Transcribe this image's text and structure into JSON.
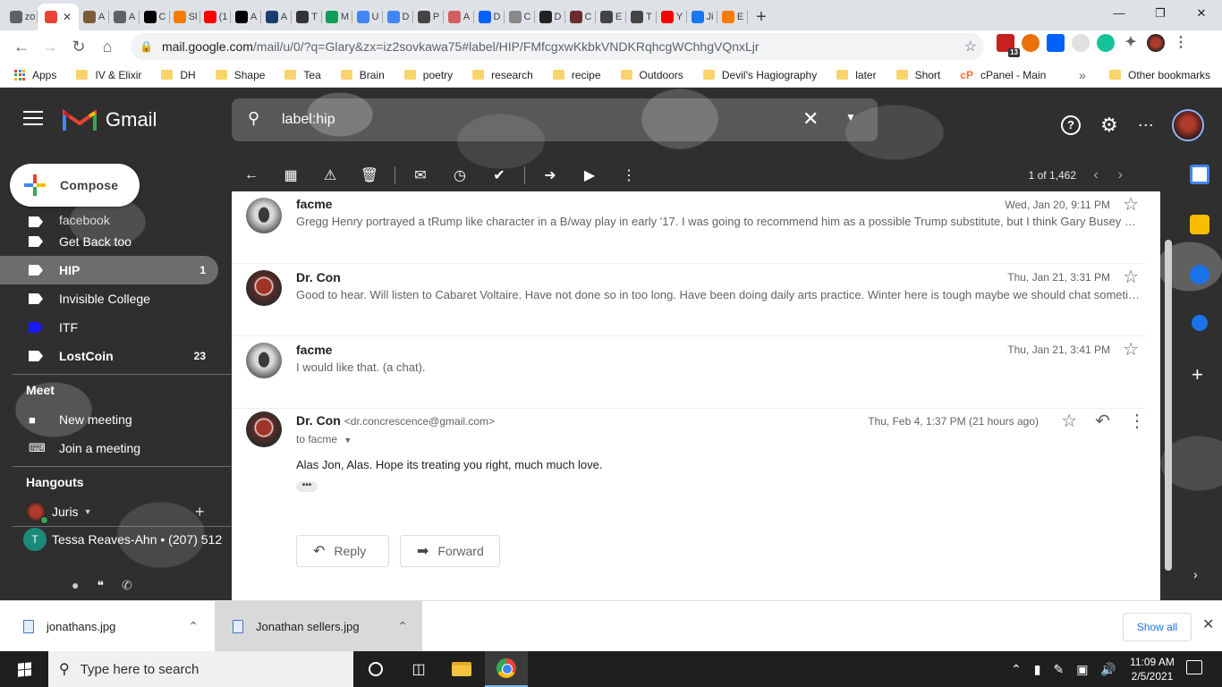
{
  "browser": {
    "tabs": [
      {
        "icon": "google-icon",
        "label": "zo",
        "color": "#5f6368"
      },
      {
        "icon": "gmail-icon",
        "label": "",
        "active": true,
        "color": "#ea4335"
      },
      {
        "icon": "image-icon",
        "label": "A",
        "color": "#7a5c3a"
      },
      {
        "icon": "globe-icon",
        "label": "A",
        "color": "#5f6368"
      },
      {
        "icon": "bbc-icon",
        "label": "C",
        "color": "#000000"
      },
      {
        "icon": "blogger-icon",
        "label": "Sl",
        "color": "#f57d00"
      },
      {
        "icon": "youtube-icon",
        "label": "(1",
        "color": "#ff0000"
      },
      {
        "icon": "medium-icon",
        "label": "A",
        "color": "#000000"
      },
      {
        "icon": "info-icon",
        "label": "A",
        "color": "#1a3d6e"
      },
      {
        "icon": "nyt-icon",
        "label": "T",
        "color": "#333333"
      },
      {
        "icon": "drive-icon",
        "label": "M",
        "color": "#0f9d58"
      },
      {
        "icon": "docs-icon",
        "label": "U",
        "color": "#4285f4"
      },
      {
        "icon": "docs-icon",
        "label": "D",
        "color": "#4285f4"
      },
      {
        "icon": "wikipedia-icon",
        "label": "P",
        "color": "#444444"
      },
      {
        "icon": "brain-icon",
        "label": "A",
        "color": "#d06060"
      },
      {
        "icon": "dropbox-icon",
        "label": "D",
        "color": "#0061fe"
      },
      {
        "icon": "feather-icon",
        "label": "C",
        "color": "#888888"
      },
      {
        "icon": "pen-icon",
        "label": "D",
        "color": "#222222"
      },
      {
        "icon": "face-icon",
        "label": "C",
        "color": "#6b2c2c"
      },
      {
        "icon": "wikipedia-icon",
        "label": "E",
        "color": "#444444"
      },
      {
        "icon": "wikipedia-icon",
        "label": "T",
        "color": "#444444"
      },
      {
        "icon": "youtube-icon",
        "label": "Y",
        "color": "#ff0000"
      },
      {
        "icon": "facebook-icon",
        "label": "Ji",
        "color": "#1877f2"
      },
      {
        "icon": "blogger-icon",
        "label": "E",
        "color": "#f57d00"
      }
    ],
    "url_host": "mail.google.com",
    "url_path": "/mail/u/0/?q=Glary&zx=iz2sovkawa75#label/HIP/FMfcgxwKkbkVNDKRqhcgWChhgVQnxLjr",
    "badge_count": "13",
    "bookmarks": {
      "apps_label": "Apps",
      "items": [
        "IV & Elixir",
        "DH",
        "Shape",
        "Tea",
        "Brain",
        "poetry",
        "research",
        "recipe",
        "Outdoors",
        "Devil's Hagiography",
        "later",
        "Short"
      ],
      "cpanel_label": "cPanel - Main",
      "other_label": "Other bookmarks"
    }
  },
  "gmail": {
    "logo_text": "Gmail",
    "search_query": "label:hip",
    "compose_label": "Compose",
    "labels": [
      {
        "name": "facebook",
        "color": "#ffffff",
        "count": "",
        "state": "cut"
      },
      {
        "name": "Get Back too",
        "color": "#ffffff",
        "count": "",
        "state": ""
      },
      {
        "name": "HIP",
        "color": "#ffffff",
        "count": "1",
        "state": "sel"
      },
      {
        "name": "Invisible College",
        "color": "#ffffff",
        "count": "",
        "state": ""
      },
      {
        "name": "ITF",
        "color": "#1a1aff",
        "count": "",
        "state": ""
      },
      {
        "name": "LostCoin",
        "color": "#ffffff",
        "count": "23",
        "state": "bold"
      }
    ],
    "meet": {
      "title": "Meet",
      "new_meeting": "New meeting",
      "join_meeting": "Join a meeting"
    },
    "hangouts": {
      "title": "Hangouts",
      "user": "Juris",
      "contact": "Tessa Reaves-Ahn • (207) 512"
    },
    "pager": "1 of 1,462",
    "thread": [
      {
        "from": "facme",
        "date": "Wed, Jan 20, 9:11 PM",
        "snippet": "Gregg Henry portrayed a tRump like character in a B/way play in early '17. I was going to recommend him as a possible Trump substitute, but I think Gary Busey would be better.",
        "avatar": "alien"
      },
      {
        "from": "Dr. Con",
        "date": "Thu, Jan 21, 3:31 PM",
        "snippet": "Good to hear. Will listen to Cabaret Voltaire. Have not done so in too long. Have been doing daily arts practice. Winter here is tough maybe we should chat sometime.",
        "avatar": "con"
      },
      {
        "from": "facme",
        "date": "Thu, Jan 21, 3:41 PM",
        "snippet": "I would like that. (a chat).",
        "avatar": "alien"
      }
    ],
    "open_message": {
      "from": "Dr. Con",
      "email": "<dr.concrescence@gmail.com>",
      "to": "to facme",
      "date": "Thu, Feb 4, 1:37 PM (21 hours ago)",
      "body": "Alas Jon, Alas. Hope its treating you right, much much love.",
      "reply_label": "Reply",
      "forward_label": "Forward"
    }
  },
  "downloads": {
    "items": [
      "jonathans.jpg",
      "Jonathan sellers.jpg"
    ],
    "show_all": "Show all"
  },
  "taskbar": {
    "search_placeholder": "Type here to search",
    "time": "11:09 AM",
    "date": "2/5/2021"
  }
}
